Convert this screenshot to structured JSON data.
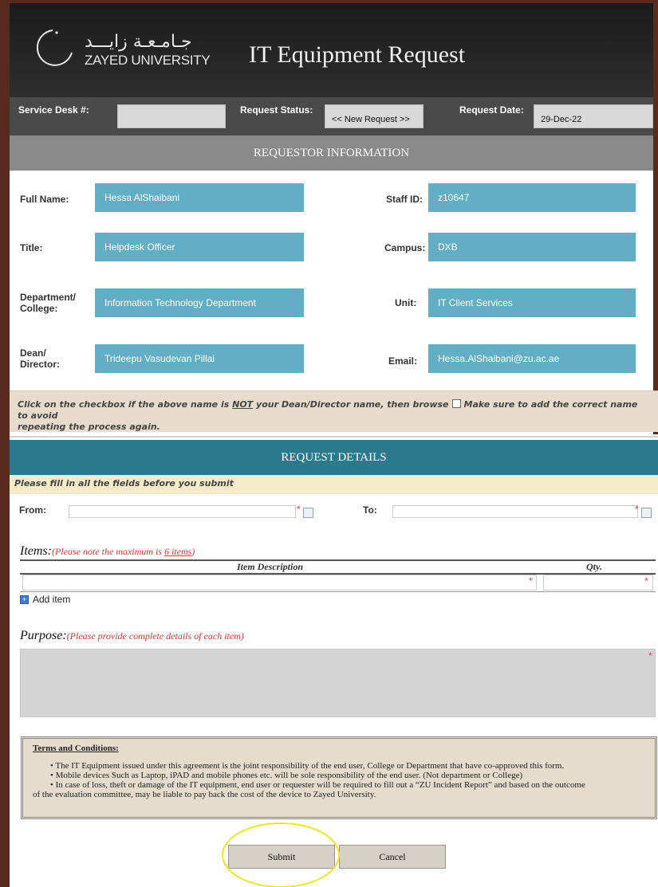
{
  "header": {
    "logo_arabic": "جـامـعـة زايـــد",
    "logo_english": "ZAYED UNIVERSITY",
    "title": "IT Equipment Request"
  },
  "status_bar": {
    "service_desk_label": "Service Desk #:",
    "service_desk_value": "",
    "request_status_label": "Request Status:",
    "request_status_value": "<< New Request >>",
    "request_date_label": "Request Date:",
    "request_date_value": "29-Dec-22"
  },
  "requestor": {
    "section_title": "REQUESTOR INFORMATION",
    "full_name_label": "Full Name:",
    "full_name": "Hessa AlShaibani",
    "staff_id_label": "Staff ID:",
    "staff_id": "z10647",
    "title_label": "Title:",
    "title": "Helpdesk Officer",
    "campus_label": "Campus:",
    "campus": "DXB",
    "department_label_1": "Department/",
    "department_label_2": "College:",
    "department": "Information Technology Department",
    "unit_label": "Unit:",
    "unit": "IT Client Services",
    "dean_label_1": "Dean/",
    "dean_label_2": "Director:",
    "dean": "Trideepu Vasudevan Pillai",
    "email_label": "Email:",
    "email": "Hessa.AlShaibani@zu.ac.ae"
  },
  "notice": {
    "part1": "Click on the checkbox if the above name is ",
    "not": "NOT",
    "part2": " your Dean/Director name, then browse",
    "part3": "Make sure to add the correct name to avoid",
    "part4": "repeating the process again."
  },
  "request_details": {
    "section_title": "REQUEST DETAILS",
    "fill_note": "Please fill in all the fields before you submit",
    "from_label": "From:",
    "to_label": "To:",
    "from_value": "",
    "to_value": ""
  },
  "items": {
    "title": "Items:",
    "note_prefix": "(Please note the maximum is ",
    "note_max": "6 items",
    "note_suffix": ")",
    "col_description": "Item Description",
    "col_qty": "Qty.",
    "add_item": "Add item"
  },
  "purpose": {
    "title": "Purpose:",
    "note": "(Please provide complete details of each item)"
  },
  "terms": {
    "title": "Terms and Conditions:",
    "lines": [
      "• The IT Equipment issued under this agreement is the joint responsibility of the end user, College or Department that have co-approved this form.",
      "• Mobile devices Such as Laptop, iPAD and mobile phones etc. will be sole responsibility of the end user. (Not department or College)",
      "• In case of loss, theft or damage of the IT equipment, end user or requester will be required to fill out a “ZU Incident Report” and based on the outcome",
      "of the evaluation committee, may be liable to pay back the cost of the device to Zayed University."
    ]
  },
  "actions": {
    "submit": "Submit",
    "cancel": "Cancel"
  },
  "required_marker": "*"
}
